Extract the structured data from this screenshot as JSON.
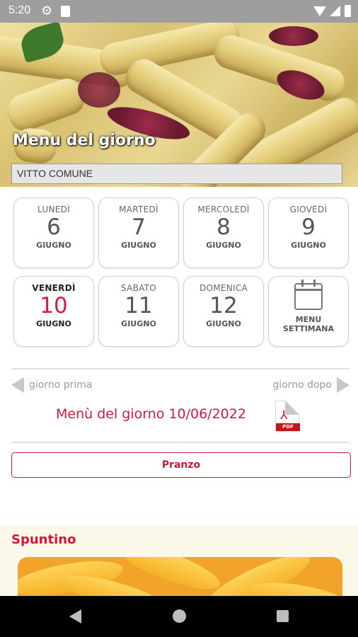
{
  "status_bar": {
    "time": "5:20",
    "icons": [
      "gear-icon",
      "sd-card-icon",
      "wifi-icon",
      "signal-icon",
      "battery-icon"
    ]
  },
  "hero": {
    "title": "Menu del giorno",
    "selector_value": "VITTO COMUNE"
  },
  "days": [
    {
      "name": "LUNEDÌ",
      "number": "6",
      "month": "GIUGNO",
      "selected": false
    },
    {
      "name": "MARTEDÌ",
      "number": "7",
      "month": "GIUGNO",
      "selected": false
    },
    {
      "name": "MERCOLEDÌ",
      "number": "8",
      "month": "GIUGNO",
      "selected": false
    },
    {
      "name": "GIOVEDÌ",
      "number": "9",
      "month": "GIUGNO",
      "selected": false
    },
    {
      "name": "VENERDÌ",
      "number": "10",
      "month": "GIUGNO",
      "selected": true
    },
    {
      "name": "SABATO",
      "number": "11",
      "month": "GIUGNO",
      "selected": false
    },
    {
      "name": "DOMENICA",
      "number": "12",
      "month": "GIUGNO",
      "selected": false
    }
  ],
  "week_menu": {
    "line1": "MENU",
    "line2": "SETTIMANA",
    "icon": "calendar-icon"
  },
  "navigation": {
    "prev_label": "giorno prima",
    "next_label": "giorno dopo"
  },
  "menu": {
    "title": "Menù del giorno 10/06/2022",
    "pdf_badge": "PDF",
    "pdf_mark": "⅄"
  },
  "meals": {
    "pranzo_label": "Pranzo",
    "spuntino_title": "Spuntino"
  },
  "colors": {
    "accent": "#d1183b",
    "status_bar": "#9e9e9e",
    "section_bg": "#fbf7e9"
  }
}
